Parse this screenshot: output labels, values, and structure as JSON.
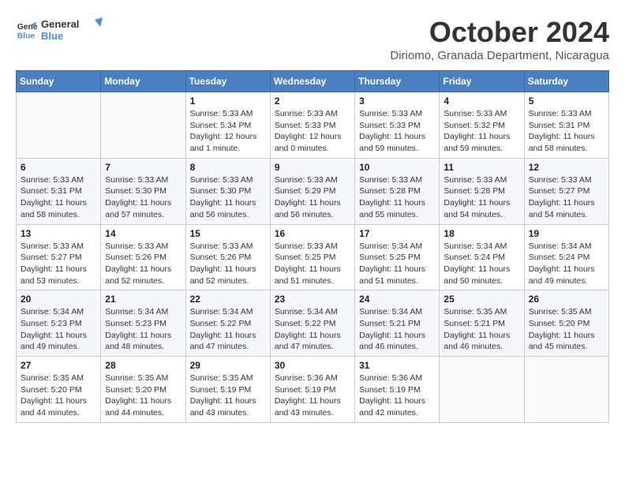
{
  "logo": {
    "line1": "General",
    "line2": "Blue"
  },
  "title": "October 2024",
  "subtitle": "Diriomo, Granada Department, Nicaragua",
  "days_header": [
    "Sunday",
    "Monday",
    "Tuesday",
    "Wednesday",
    "Thursday",
    "Friday",
    "Saturday"
  ],
  "weeks": [
    [
      {
        "num": "",
        "info": ""
      },
      {
        "num": "",
        "info": ""
      },
      {
        "num": "1",
        "info": "Sunrise: 5:33 AM\nSunset: 5:34 PM\nDaylight: 12 hours\nand 1 minute."
      },
      {
        "num": "2",
        "info": "Sunrise: 5:33 AM\nSunset: 5:33 PM\nDaylight: 12 hours\nand 0 minutes."
      },
      {
        "num": "3",
        "info": "Sunrise: 5:33 AM\nSunset: 5:33 PM\nDaylight: 11 hours\nand 59 minutes."
      },
      {
        "num": "4",
        "info": "Sunrise: 5:33 AM\nSunset: 5:32 PM\nDaylight: 11 hours\nand 59 minutes."
      },
      {
        "num": "5",
        "info": "Sunrise: 5:33 AM\nSunset: 5:31 PM\nDaylight: 11 hours\nand 58 minutes."
      }
    ],
    [
      {
        "num": "6",
        "info": "Sunrise: 5:33 AM\nSunset: 5:31 PM\nDaylight: 11 hours\nand 58 minutes."
      },
      {
        "num": "7",
        "info": "Sunrise: 5:33 AM\nSunset: 5:30 PM\nDaylight: 11 hours\nand 57 minutes."
      },
      {
        "num": "8",
        "info": "Sunrise: 5:33 AM\nSunset: 5:30 PM\nDaylight: 11 hours\nand 56 minutes."
      },
      {
        "num": "9",
        "info": "Sunrise: 5:33 AM\nSunset: 5:29 PM\nDaylight: 11 hours\nand 56 minutes."
      },
      {
        "num": "10",
        "info": "Sunrise: 5:33 AM\nSunset: 5:28 PM\nDaylight: 11 hours\nand 55 minutes."
      },
      {
        "num": "11",
        "info": "Sunrise: 5:33 AM\nSunset: 5:28 PM\nDaylight: 11 hours\nand 54 minutes."
      },
      {
        "num": "12",
        "info": "Sunrise: 5:33 AM\nSunset: 5:27 PM\nDaylight: 11 hours\nand 54 minutes."
      }
    ],
    [
      {
        "num": "13",
        "info": "Sunrise: 5:33 AM\nSunset: 5:27 PM\nDaylight: 11 hours\nand 53 minutes."
      },
      {
        "num": "14",
        "info": "Sunrise: 5:33 AM\nSunset: 5:26 PM\nDaylight: 11 hours\nand 52 minutes."
      },
      {
        "num": "15",
        "info": "Sunrise: 5:33 AM\nSunset: 5:26 PM\nDaylight: 11 hours\nand 52 minutes."
      },
      {
        "num": "16",
        "info": "Sunrise: 5:33 AM\nSunset: 5:25 PM\nDaylight: 11 hours\nand 51 minutes."
      },
      {
        "num": "17",
        "info": "Sunrise: 5:34 AM\nSunset: 5:25 PM\nDaylight: 11 hours\nand 51 minutes."
      },
      {
        "num": "18",
        "info": "Sunrise: 5:34 AM\nSunset: 5:24 PM\nDaylight: 11 hours\nand 50 minutes."
      },
      {
        "num": "19",
        "info": "Sunrise: 5:34 AM\nSunset: 5:24 PM\nDaylight: 11 hours\nand 49 minutes."
      }
    ],
    [
      {
        "num": "20",
        "info": "Sunrise: 5:34 AM\nSunset: 5:23 PM\nDaylight: 11 hours\nand 49 minutes."
      },
      {
        "num": "21",
        "info": "Sunrise: 5:34 AM\nSunset: 5:23 PM\nDaylight: 11 hours\nand 48 minutes."
      },
      {
        "num": "22",
        "info": "Sunrise: 5:34 AM\nSunset: 5:22 PM\nDaylight: 11 hours\nand 47 minutes."
      },
      {
        "num": "23",
        "info": "Sunrise: 5:34 AM\nSunset: 5:22 PM\nDaylight: 11 hours\nand 47 minutes."
      },
      {
        "num": "24",
        "info": "Sunrise: 5:34 AM\nSunset: 5:21 PM\nDaylight: 11 hours\nand 46 minutes."
      },
      {
        "num": "25",
        "info": "Sunrise: 5:35 AM\nSunset: 5:21 PM\nDaylight: 11 hours\nand 46 minutes."
      },
      {
        "num": "26",
        "info": "Sunrise: 5:35 AM\nSunset: 5:20 PM\nDaylight: 11 hours\nand 45 minutes."
      }
    ],
    [
      {
        "num": "27",
        "info": "Sunrise: 5:35 AM\nSunset: 5:20 PM\nDaylight: 11 hours\nand 44 minutes."
      },
      {
        "num": "28",
        "info": "Sunrise: 5:35 AM\nSunset: 5:20 PM\nDaylight: 11 hours\nand 44 minutes."
      },
      {
        "num": "29",
        "info": "Sunrise: 5:35 AM\nSunset: 5:19 PM\nDaylight: 11 hours\nand 43 minutes."
      },
      {
        "num": "30",
        "info": "Sunrise: 5:36 AM\nSunset: 5:19 PM\nDaylight: 11 hours\nand 43 minutes."
      },
      {
        "num": "31",
        "info": "Sunrise: 5:36 AM\nSunset: 5:19 PM\nDaylight: 11 hours\nand 42 minutes."
      },
      {
        "num": "",
        "info": ""
      },
      {
        "num": "",
        "info": ""
      }
    ]
  ]
}
